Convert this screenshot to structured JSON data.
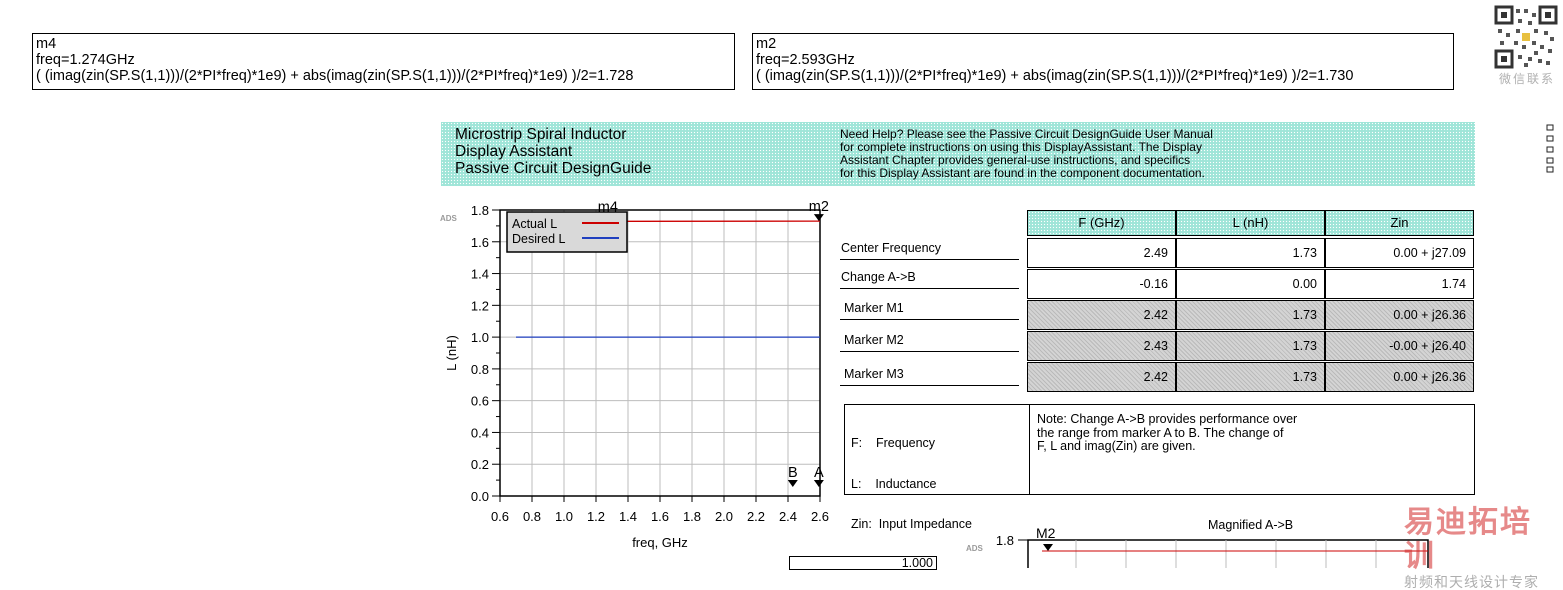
{
  "marker_boxes": [
    {
      "name": "m4",
      "freq": "freq=1.274GHz",
      "expr": "( (imag(zin(SP.S(1,1)))/(2*PI*freq)*1e9) + abs(imag(zin(SP.S(1,1)))/(2*PI*freq)*1e9) )/2=1.728"
    },
    {
      "name": "m2",
      "freq": "freq=2.593GHz",
      "expr": "( (imag(zin(SP.S(1,1)))/(2*PI*freq)*1e9) + abs(imag(zin(SP.S(1,1)))/(2*PI*freq)*1e9) )/2=1.730"
    }
  ],
  "header": {
    "title_lines": [
      "Microstrip Spiral Inductor",
      "Display Assistant",
      "Passive Circuit DesignGuide"
    ],
    "help_lines": [
      "Need Help? Please see the Passive Circuit DesignGuide User Manual",
      "for complete instructions on using this DisplayAssistant.  The Display",
      "Assistant Chapter provides general-use instructions, and specifics",
      "for this Display Assistant are found in the component documentation."
    ]
  },
  "main_chart": {
    "ads_tag": "ADS",
    "ylabel": "L (nH)",
    "xlabel": "freq, GHz",
    "legend": [
      "Actual L",
      "Desired L"
    ],
    "markers": [
      "m4",
      "m2",
      "B",
      "A"
    ]
  },
  "chart_data": [
    {
      "type": "line",
      "xlim": [
        0.6,
        2.6
      ],
      "ylim": [
        0.0,
        1.8
      ],
      "x_ticks": [
        "0.6",
        "0.8",
        "1.0",
        "1.2",
        "1.4",
        "1.6",
        "1.8",
        "2.0",
        "2.2",
        "2.4",
        "2.6"
      ],
      "y_ticks": [
        "0.0",
        "0.2",
        "0.4",
        "0.6",
        "0.8",
        "1.0",
        "1.2",
        "1.4",
        "1.6",
        "1.8"
      ],
      "grid": true,
      "legend_position": "top-left",
      "series": [
        {
          "name": "Actual L",
          "color": "#cc0000",
          "x": [
            0.7,
            2.6
          ],
          "y": [
            1.728,
            1.73
          ]
        },
        {
          "name": "Desired L",
          "color": "#1f3fbf",
          "x": [
            0.7,
            2.6
          ],
          "y": [
            1.0,
            1.0
          ]
        }
      ],
      "markers": [
        {
          "label": "m4",
          "x": 1.274,
          "y": 1.728
        },
        {
          "label": "m2",
          "x": 2.593,
          "y": 1.73
        },
        {
          "label": "B",
          "x": 2.43,
          "y": 0.0
        },
        {
          "label": "A",
          "x": 2.593,
          "y": 0.0
        }
      ]
    },
    {
      "type": "line",
      "title": "Magnified A->B",
      "y_ticks": [
        "1.8"
      ],
      "markers": [
        {
          "label": "M2"
        }
      ]
    }
  ],
  "results_table": {
    "headers": [
      "F (GHz)",
      "L (nH)",
      "Zin"
    ],
    "rows": [
      {
        "label": "Center Frequency",
        "values": [
          "2.49",
          "1.73",
          "0.00 + j27.09"
        ]
      },
      {
        "label": "Change A->B",
        "values": [
          "-0.16",
          "0.00",
          "1.74"
        ]
      },
      {
        "label": "Marker M1",
        "values": [
          "2.42",
          "1.73",
          "0.00 + j26.36"
        ]
      },
      {
        "label": "Marker M2",
        "values": [
          "2.43",
          "1.73",
          "-0.00 + j26.40"
        ]
      },
      {
        "label": "Marker M3",
        "values": [
          "2.42",
          "1.73",
          "0.00 + j26.36"
        ]
      }
    ]
  },
  "legend_box": {
    "left_lines": [
      "F:    Frequency",
      "L:    Inductance",
      "Zin:  Input Impedance"
    ],
    "note_lines": [
      "Note: Change A->B provides performance over",
      "the range from marker A to B. The change of",
      "F, L and imag(Zin) are given."
    ]
  },
  "bottom_value": "1.000",
  "magnified_chart": {
    "title": "Magnified A->B",
    "ads_tag": "ADS",
    "y_tick": "1.8",
    "marker": "M2"
  },
  "watermark": {
    "qr_caption": "微信联系",
    "logo_text": "易迪拓培训",
    "logo_subtext": "射频和天线设计专家"
  }
}
